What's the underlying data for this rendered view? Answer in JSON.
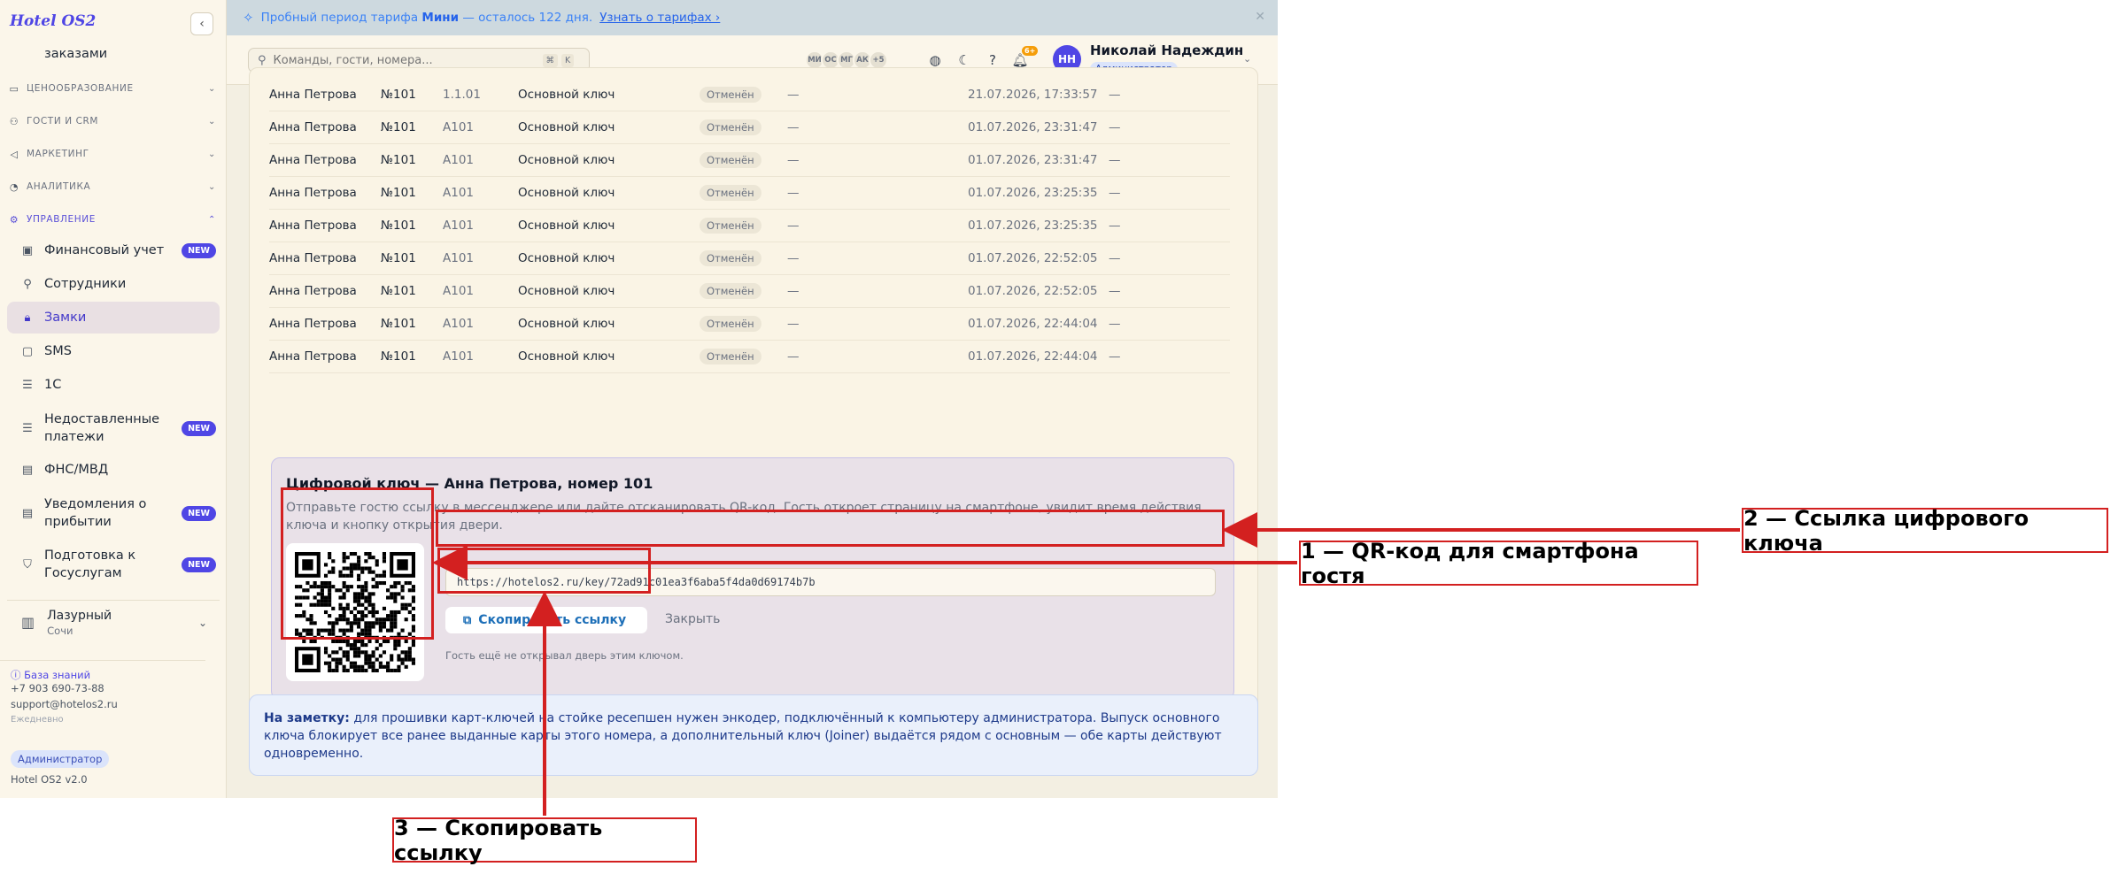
{
  "app": {
    "brand": "Hotel OS2",
    "collapse_icon": "chevron-left-icon"
  },
  "banner": {
    "text_before": "Пробный период тарифа",
    "plan": "Мини",
    "text_after": "— осталось 122 дня.",
    "link": "Узнать о тарифах ›"
  },
  "sidebar": {
    "partial_item": "заказами",
    "sections": [
      {
        "label": "ЦЕНООБРАЗОВАНИЕ",
        "icon": "price-tag-icon"
      },
      {
        "label": "ГОСТИ И CRM",
        "icon": "users-icon"
      },
      {
        "label": "МАРКЕТИНГ",
        "icon": "megaphone-icon"
      },
      {
        "label": "АНАЛИТИКА",
        "icon": "analytics-icon"
      },
      {
        "label": "УПРАВЛЕНИЕ",
        "icon": "gear-icon"
      }
    ],
    "items": [
      {
        "label": "Финансовый учет",
        "badge": "NEW",
        "icon": "wallet-icon"
      },
      {
        "label": "Сотрудники",
        "badge": "",
        "icon": "user-icon"
      },
      {
        "label": "Замки",
        "badge": "",
        "icon": "lock-icon"
      },
      {
        "label": "SMS",
        "badge": "",
        "icon": "message-icon"
      },
      {
        "label": "1С",
        "badge": "",
        "icon": "database-icon"
      },
      {
        "label_l1": "Недоставленные",
        "label_l2": "платежи",
        "badge": "NEW",
        "icon": "database-icon"
      },
      {
        "label": "ФНС/МВД",
        "badge": "",
        "icon": "document-icon"
      },
      {
        "label_l1": "Уведомления о",
        "label_l2": "прибытии",
        "badge": "NEW",
        "icon": "document-icon"
      },
      {
        "label_l1": "Подготовка к",
        "label_l2": "Госуслугам",
        "badge": "NEW",
        "icon": "shield-icon"
      }
    ],
    "hotel": {
      "name": "Лазурный",
      "city": "Сочи"
    },
    "footer": {
      "kb": "База знаний",
      "phone": "+7 903 690-73-88",
      "email": "support@hotelos2.ru",
      "schedule": "Ежедневно",
      "role": "Администратор",
      "version": "Hotel OS2 v2.0"
    }
  },
  "topbar": {
    "search_placeholder": "Команды, гости, номера...",
    "kbd1": "⌘",
    "kbd2": "K",
    "avatars": [
      "МИ",
      "ОС",
      "МГ",
      "АК",
      "+5"
    ],
    "notif_count": "6+",
    "user": {
      "initials": "НН",
      "name": "Николай Надеждин",
      "role": "Администратор"
    }
  },
  "log": {
    "rows": [
      {
        "guest": "Анна Петрова",
        "room": "№101",
        "unit": "1.1.01",
        "type": "Основной ключ",
        "status": "Отменён",
        "dash1": "—",
        "time": "21.07.2026, 17:33:57",
        "dash2": "—"
      },
      {
        "guest": "Анна Петрова",
        "room": "№101",
        "unit": "A101",
        "type": "Основной ключ",
        "status": "Отменён",
        "dash1": "—",
        "time": "01.07.2026, 23:31:47",
        "dash2": "—"
      },
      {
        "guest": "Анна Петрова",
        "room": "№101",
        "unit": "A101",
        "type": "Основной ключ",
        "status": "Отменён",
        "dash1": "—",
        "time": "01.07.2026, 23:31:47",
        "dash2": "—"
      },
      {
        "guest": "Анна Петрова",
        "room": "№101",
        "unit": "A101",
        "type": "Основной ключ",
        "status": "Отменён",
        "dash1": "—",
        "time": "01.07.2026, 23:25:35",
        "dash2": "—"
      },
      {
        "guest": "Анна Петрова",
        "room": "№101",
        "unit": "A101",
        "type": "Основной ключ",
        "status": "Отменён",
        "dash1": "—",
        "time": "01.07.2026, 23:25:35",
        "dash2": "—"
      },
      {
        "guest": "Анна Петрова",
        "room": "№101",
        "unit": "A101",
        "type": "Основной ключ",
        "status": "Отменён",
        "dash1": "—",
        "time": "01.07.2026, 22:52:05",
        "dash2": "—"
      },
      {
        "guest": "Анна Петрова",
        "room": "№101",
        "unit": "A101",
        "type": "Основной ключ",
        "status": "Отменён",
        "dash1": "—",
        "time": "01.07.2026, 22:52:05",
        "dash2": "—"
      },
      {
        "guest": "Анна Петрова",
        "room": "№101",
        "unit": "A101",
        "type": "Основной ключ",
        "status": "Отменён",
        "dash1": "—",
        "time": "01.07.2026, 22:44:04",
        "dash2": "—"
      },
      {
        "guest": "Анна Петрова",
        "room": "№101",
        "unit": "A101",
        "type": "Основной ключ",
        "status": "Отменён",
        "dash1": "—",
        "time": "01.07.2026, 22:44:04",
        "dash2": "—"
      }
    ]
  },
  "key_panel": {
    "title": "Цифровой ключ — Анна Петрова, номер 101",
    "description": "Отправьте гостю ссылку в мессенджере или дайте отсканировать QR-код. Гость откроет страницу на смартфоне, увидит время действия ключа и кнопку открытия двери.",
    "url": "https://hotelos2.ru/key/72ad91c01ea3f6aba5f4da0d69174b7b",
    "copy_label": "Скопировать ссылку",
    "close_label": "Закрыть",
    "hint": "Гость ещё не открывал дверь этим ключом."
  },
  "note": {
    "bold": "На заметку:",
    "text": "для прошивки карт-ключей на стойке ресепшен нужен энкодер, подключённый к компьютеру администратора. Выпуск основного ключа блокирует все ранее выданные карты этого номера, а дополнительный ключ (Joiner) выдаётся рядом с основным — обе карты действуют одновременно."
  },
  "annotations": {
    "a1": "1 — QR-код для смартфона гостя",
    "a2": "2 — Ссылка цифрового ключа",
    "a3": "3 — Скопировать ссылку"
  },
  "colors": {
    "accent": "#4f46e5",
    "annotation": "#d32020",
    "banner_bg": "#cdd9df"
  }
}
